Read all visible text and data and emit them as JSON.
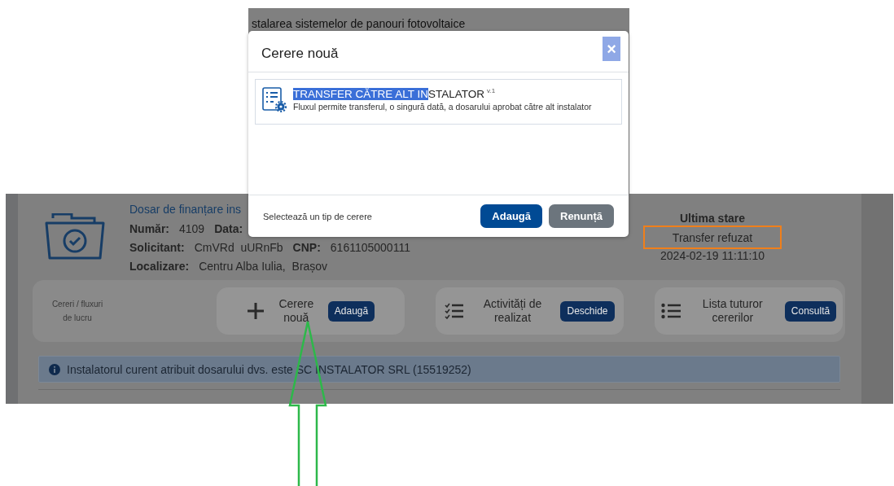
{
  "background_page": {
    "heading": "stalarea sistemelor de panouri fotovoltaice"
  },
  "dossier": {
    "title": "Dosar de finanțare ins",
    "lines": [
      {
        "fields": [
          {
            "label": "Număr:",
            "value": "4109"
          },
          {
            "label": "Data:"
          }
        ]
      },
      {
        "fields": [
          {
            "label": "Solicitant:",
            "value": "CmVRd  uURnFb"
          },
          {
            "label": "CNP:",
            "value": "6161105000111"
          }
        ]
      },
      {
        "fields": [
          {
            "label": "Localizare:",
            "value": "Centru Alba Iulia,  Brașov"
          }
        ]
      }
    ]
  },
  "status": {
    "heading": "Ultima stare",
    "value": "Transfer refuzat",
    "highlighted": true,
    "timestamp": "2024-02-19 11:11:10"
  },
  "actions": {
    "label": "Cereri / fluxuri de lucru",
    "items": [
      {
        "kind": "plus",
        "label": "Cerere nouă",
        "button": "Adaugă"
      },
      {
        "kind": "checklist",
        "label": "Activități de realizat",
        "button": "Deschide"
      },
      {
        "kind": "list",
        "label": "Lista tuturor cererilor",
        "button": "Consultă"
      }
    ]
  },
  "info": {
    "text": "Instalatorul curent atribuit dosarului dvs. este SC INSTALATOR SRL (15519252)"
  },
  "modal": {
    "title": "Cerere nouă",
    "close": "×",
    "options": [
      {
        "title_selected": "TRANSFER CĂTRE ALT IN",
        "title_rest": "STALATOR",
        "version": "v.1",
        "description": "Fluxul permite transferul, o singură dată, a dosarului aprobat către alt instalator"
      }
    ],
    "footer_hint": "Selectează un tip de cerere",
    "buttons": [
      {
        "kind": "primary",
        "label": "Adaugă"
      },
      {
        "kind": "secondary",
        "label": "Renunță"
      }
    ]
  }
}
